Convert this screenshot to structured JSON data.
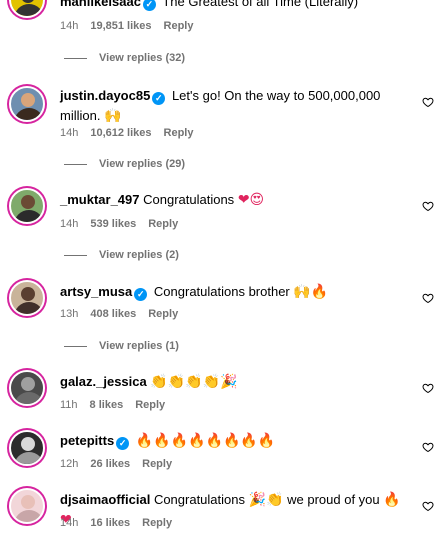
{
  "comments": [
    {
      "username": "manlikeisaac",
      "verified": true,
      "text": "The Greatest of all Time (Literally)",
      "emoji": "",
      "time": "14h",
      "likes": "19,851 likes",
      "reply_label": "Reply",
      "view_replies": "View replies (32)",
      "avatar_bg": "#e2c200",
      "avatar_fg": "#333333"
    },
    {
      "username": "justin.dayoc85",
      "verified": true,
      "text": "Let's go! On the way to 500,000,000 million.",
      "emoji": "🙌",
      "time": "14h",
      "likes": "10,612 likes",
      "reply_label": "Reply",
      "view_replies": "View replies (29)",
      "avatar_bg": "#6e8fb0",
      "avatar_fg": "#3a2a1e"
    },
    {
      "username": "_muktar_497",
      "verified": false,
      "text": "Congratulations",
      "emoji": "❤😍",
      "time": "14h",
      "likes": "539 likes",
      "reply_label": "Reply",
      "view_replies": "View replies (2)",
      "avatar_bg": "#7faa6b",
      "avatar_fg": "#2b2b2b"
    },
    {
      "username": "artsy_musa",
      "verified": true,
      "text": "Congratulations brother",
      "emoji": "🙌🔥",
      "time": "13h",
      "likes": "408 likes",
      "reply_label": "Reply",
      "view_replies": "View replies (1)",
      "avatar_bg": "#c9b49a",
      "avatar_fg": "#40302a"
    },
    {
      "username": "galaz._jessica",
      "verified": false,
      "text": "",
      "emoji": "👏👏👏👏🎉",
      "time": "11h",
      "likes": "8 likes",
      "reply_label": "Reply",
      "view_replies": "",
      "avatar_bg": "#4a4a4a",
      "avatar_fg": "#a0a0a0"
    },
    {
      "username": "petepitts",
      "verified": true,
      "text": "",
      "emoji": "🔥🔥🔥🔥🔥🔥🔥🔥",
      "time": "12h",
      "likes": "26 likes",
      "reply_label": "Reply",
      "view_replies": "",
      "avatar_bg": "#2c2c2c",
      "avatar_fg": "#d8d8d8"
    },
    {
      "username": "djsaimaofficial",
      "verified": false,
      "text": "Congratulations",
      "emoji": "🎉👏",
      "text2": "we proud of you",
      "emoji2": "🔥❤",
      "time": "14h",
      "likes": "16 likes",
      "reply_label": "Reply",
      "view_replies": "",
      "avatar_bg": "#f2d6d9",
      "avatar_fg": "#c8a6a8"
    }
  ],
  "colors": {
    "verified": "#0095f6",
    "meta": "#737373",
    "story_ring": "#d6249f"
  },
  "icons": {
    "heart": "heart-outline-icon",
    "verified": "verified-badge-icon"
  }
}
